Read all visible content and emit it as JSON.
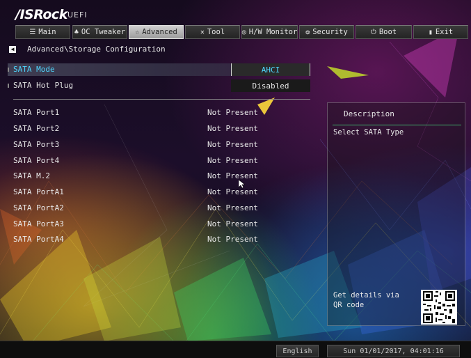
{
  "header": {
    "brand": "/ISRock",
    "brand_suffix": "UEFI"
  },
  "tabs": [
    {
      "label": "Main",
      "icon": "list-icon",
      "glyph": "☰"
    },
    {
      "label": "OC Tweaker",
      "icon": "rocket-icon",
      "glyph": "♣"
    },
    {
      "label": "Advanced",
      "icon": "star-icon",
      "glyph": "☆",
      "active": true
    },
    {
      "label": "Tool",
      "icon": "tool-icon",
      "glyph": "✕"
    },
    {
      "label": "H/W Monitor",
      "icon": "monitor-icon",
      "glyph": "◎"
    },
    {
      "label": "Security",
      "icon": "shield-icon",
      "glyph": "❂"
    },
    {
      "label": "Boot",
      "icon": "power-icon",
      "glyph": "⏻"
    },
    {
      "label": "Exit",
      "icon": "exit-icon",
      "glyph": "▮"
    }
  ],
  "breadcrumb": "Advanced\\Storage Configuration",
  "settings": {
    "sata_mode": {
      "label": "SATA Mode",
      "value": "AHCI"
    },
    "sata_hot_plug": {
      "label": "SATA Hot Plug",
      "value": "Disabled"
    }
  },
  "ports": [
    {
      "label": "SATA Port1",
      "value": "Not Present"
    },
    {
      "label": "SATA Port2",
      "value": "Not Present"
    },
    {
      "label": "SATA Port3",
      "value": "Not Present"
    },
    {
      "label": "SATA Port4",
      "value": "Not Present"
    },
    {
      "label": "SATA M.2",
      "value": "Not Present"
    },
    {
      "label": "SATA PortA1",
      "value": "Not Present"
    },
    {
      "label": "SATA PortA2",
      "value": "Not Present"
    },
    {
      "label": "SATA PortA3",
      "value": "Not Present"
    },
    {
      "label": "SATA PortA4",
      "value": "Not Present"
    }
  ],
  "description": {
    "title": "Description",
    "text": "Select SATA Type",
    "qr_text": "Get details via QR code"
  },
  "footer": {
    "language": "English",
    "datetime": "Sun 01/01/2017, 04:01:16"
  },
  "colors": {
    "highlight_value": "#4fd8ff",
    "accent_line": "#3fb36b"
  }
}
